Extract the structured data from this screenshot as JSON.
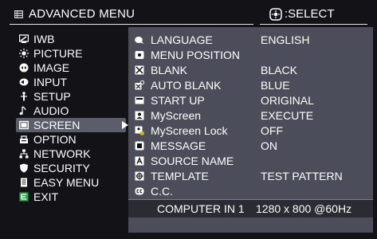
{
  "header": {
    "title": "ADVANCED MENU",
    "select_label": ":SELECT"
  },
  "left_menu": {
    "items": [
      {
        "label": "IWB",
        "icon": "iwb-icon"
      },
      {
        "label": "PICTURE",
        "icon": "picture-icon"
      },
      {
        "label": "IMAGE",
        "icon": "image-icon"
      },
      {
        "label": "INPUT",
        "icon": "input-icon"
      },
      {
        "label": "SETUP",
        "icon": "setup-icon"
      },
      {
        "label": "AUDIO",
        "icon": "audio-icon"
      },
      {
        "label": "SCREEN",
        "icon": "screen-icon",
        "active": true
      },
      {
        "label": "OPTION",
        "icon": "option-icon"
      },
      {
        "label": "NETWORK",
        "icon": "network-icon"
      },
      {
        "label": "SECURITY",
        "icon": "security-icon"
      },
      {
        "label": "EASY MENU",
        "icon": "easy-menu-icon"
      },
      {
        "label": "EXIT",
        "icon": "exit-icon"
      }
    ]
  },
  "screen_panel": {
    "rows": [
      {
        "label": "LANGUAGE",
        "value": "ENGLISH",
        "icon": "language-icon"
      },
      {
        "label": "MENU POSITION",
        "value": "",
        "icon": "menu-position-icon"
      },
      {
        "label": "BLANK",
        "value": "BLACK",
        "icon": "blank-icon"
      },
      {
        "label": "AUTO BLANK",
        "value": "BLUE",
        "icon": "auto-blank-icon"
      },
      {
        "label": "START UP",
        "value": "ORIGINAL",
        "icon": "start-up-icon"
      },
      {
        "label": "MyScreen",
        "value": "EXECUTE",
        "icon": "myscreen-icon"
      },
      {
        "label": "MyScreen Lock",
        "value": "OFF",
        "icon": "myscreen-lock-icon"
      },
      {
        "label": "MESSAGE",
        "value": "ON",
        "icon": "message-icon"
      },
      {
        "label": "SOURCE NAME",
        "value": "",
        "icon": "source-name-icon"
      },
      {
        "label": "TEMPLATE",
        "value": "TEST PATTERN",
        "icon": "template-icon"
      },
      {
        "label": "C.C.",
        "value": "",
        "icon": "cc-icon"
      }
    ]
  },
  "status_bar": {
    "source": "COMPUTER IN 1",
    "resolution": "1280 x 800 @60Hz"
  },
  "colors": {
    "background": "#121217",
    "panel": "#4c4d5a",
    "active_item": "#5b5d6b",
    "text": "#ffffff"
  }
}
